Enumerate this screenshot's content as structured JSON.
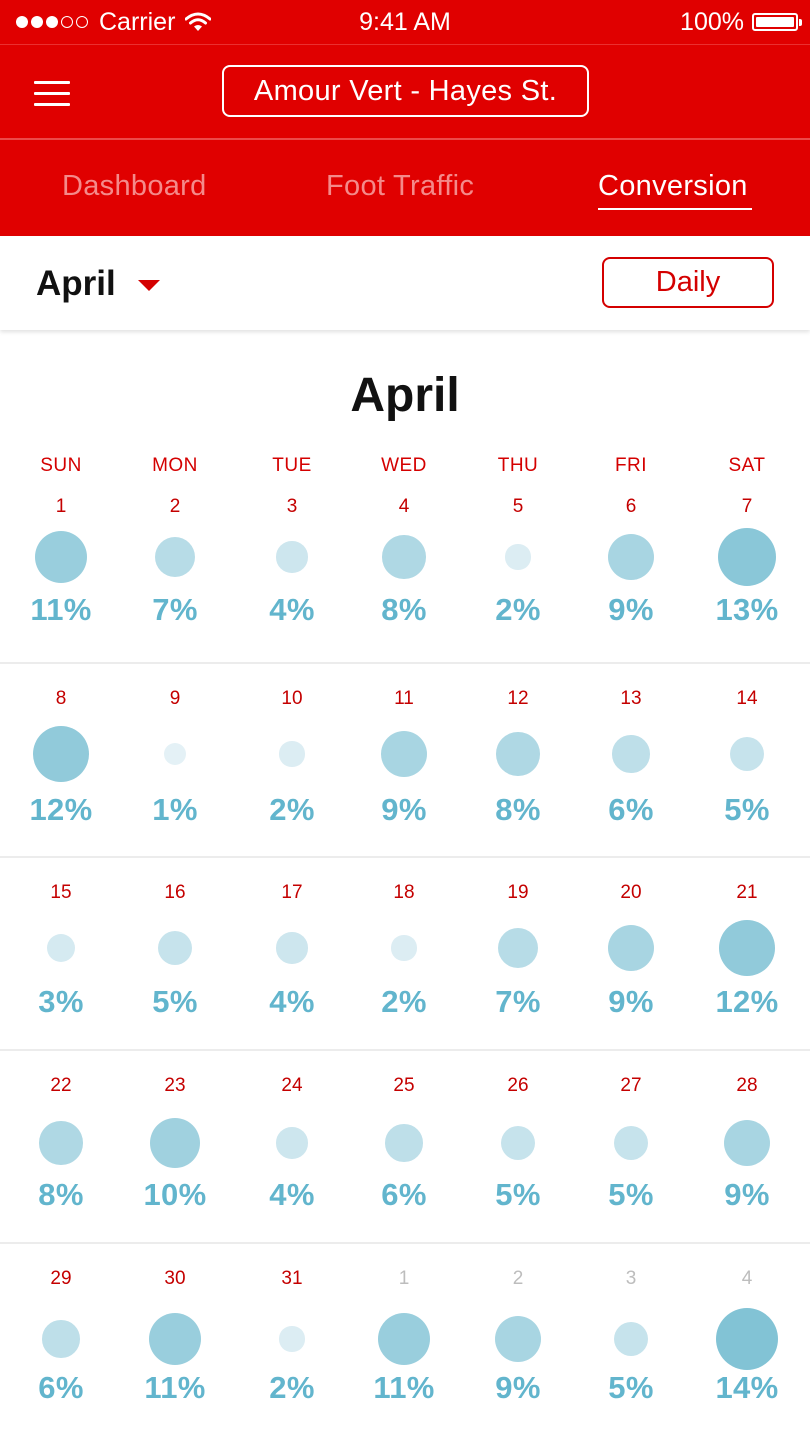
{
  "status_bar": {
    "carrier": "Carrier",
    "time": "9:41 AM",
    "battery": "100%",
    "signal_icon": "signal-dots-icon",
    "wifi_icon": "wifi-icon",
    "battery_icon": "battery-icon"
  },
  "nav": {
    "menu_icon": "hamburger-menu-icon",
    "store_name": "Amour Vert - Hayes St."
  },
  "tabs": [
    {
      "label": "Dashboard",
      "active": false
    },
    {
      "label": "Foot Traffic",
      "active": false
    },
    {
      "label": "Conversion",
      "active": true
    }
  ],
  "filter": {
    "month": "April",
    "period": "Daily",
    "caret_icon": "caret-down-icon"
  },
  "calendar": {
    "title": "April",
    "weekdays": [
      "SUN",
      "MON",
      "TUE",
      "WED",
      "THU",
      "FRI",
      "SAT"
    ],
    "weeks": [
      [
        {
          "day": "1",
          "pct": "11%",
          "v": 11
        },
        {
          "day": "2",
          "pct": "7%",
          "v": 7
        },
        {
          "day": "3",
          "pct": "4%",
          "v": 4
        },
        {
          "day": "4",
          "pct": "8%",
          "v": 8
        },
        {
          "day": "5",
          "pct": "2%",
          "v": 2
        },
        {
          "day": "6",
          "pct": "9%",
          "v": 9
        },
        {
          "day": "7",
          "pct": "13%",
          "v": 13
        }
      ],
      [
        {
          "day": "8",
          "pct": "12%",
          "v": 12
        },
        {
          "day": "9",
          "pct": "1%",
          "v": 1
        },
        {
          "day": "10",
          "pct": "2%",
          "v": 2
        },
        {
          "day": "11",
          "pct": "9%",
          "v": 9
        },
        {
          "day": "12",
          "pct": "8%",
          "v": 8
        },
        {
          "day": "13",
          "pct": "6%",
          "v": 6
        },
        {
          "day": "14",
          "pct": "5%",
          "v": 5
        }
      ],
      [
        {
          "day": "15",
          "pct": "3%",
          "v": 3
        },
        {
          "day": "16",
          "pct": "5%",
          "v": 5
        },
        {
          "day": "17",
          "pct": "4%",
          "v": 4
        },
        {
          "day": "18",
          "pct": "2%",
          "v": 2
        },
        {
          "day": "19",
          "pct": "7%",
          "v": 7
        },
        {
          "day": "20",
          "pct": "9%",
          "v": 9
        },
        {
          "day": "21",
          "pct": "12%",
          "v": 12
        }
      ],
      [
        {
          "day": "22",
          "pct": "8%",
          "v": 8
        },
        {
          "day": "23",
          "pct": "10%",
          "v": 10
        },
        {
          "day": "24",
          "pct": "4%",
          "v": 4
        },
        {
          "day": "25",
          "pct": "6%",
          "v": 6
        },
        {
          "day": "26",
          "pct": "5%",
          "v": 5
        },
        {
          "day": "27",
          "pct": "5%",
          "v": 5
        },
        {
          "day": "28",
          "pct": "9%",
          "v": 9
        }
      ],
      [
        {
          "day": "29",
          "pct": "6%",
          "v": 6
        },
        {
          "day": "30",
          "pct": "11%",
          "v": 11
        },
        {
          "day": "31",
          "pct": "2%",
          "v": 2
        },
        {
          "day": "1",
          "pct": "11%",
          "v": 11,
          "other_month": true
        },
        {
          "day": "2",
          "pct": "9%",
          "v": 9,
          "other_month": true
        },
        {
          "day": "3",
          "pct": "5%",
          "v": 5,
          "other_month": true
        },
        {
          "day": "4",
          "pct": "14%",
          "v": 14,
          "other_month": true
        }
      ]
    ]
  },
  "colors": {
    "brand_red": "#e00000",
    "accent_red": "#d40000",
    "percent_blue": "#62b5cd",
    "bubble_dark": "#82c3d5",
    "bubble_light": "#e4f1f6"
  }
}
